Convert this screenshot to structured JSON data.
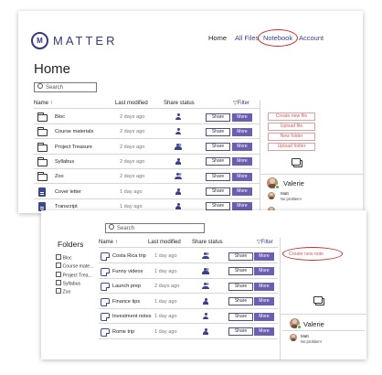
{
  "app": {
    "name": "MATTER",
    "logo_mark": "M"
  },
  "nav": {
    "items": [
      "Home",
      "All Files",
      "Notebook",
      "Account"
    ],
    "highlighted": "Notebook"
  },
  "top_panel": {
    "title": "Home",
    "search_placeholder": "Search",
    "columns": {
      "name": "Name",
      "sort_indicator": "↑",
      "modified": "Last modified",
      "share": "Share status"
    },
    "filter": "Filter",
    "rows": [
      {
        "name": "Bloc",
        "modified": "2 days ago",
        "type": "folder",
        "share": "person"
      },
      {
        "name": "Course materials",
        "modified": "2 days ago",
        "type": "folder",
        "share": "person"
      },
      {
        "name": "Project Treasure",
        "modified": "2 days ago",
        "type": "folder",
        "share": "group"
      },
      {
        "name": "Syllabus",
        "modified": "2 days ago",
        "type": "folder",
        "share": "person"
      },
      {
        "name": "Zoo",
        "modified": "2 days ago",
        "type": "folder",
        "share": "group"
      },
      {
        "name": "Cover letter",
        "modified": "1 day ago",
        "type": "doc",
        "share": "person"
      },
      {
        "name": "Transcript",
        "modified": "1 day ago",
        "type": "doc",
        "share": "person"
      }
    ],
    "share_label": "Share",
    "more_label": "More",
    "actions": [
      "Create new file",
      "Upload file",
      "New folder",
      "Upload folder"
    ],
    "user": "Valerie",
    "message": {
      "from": "Matt",
      "text": "No problem!"
    }
  },
  "bottom_panel": {
    "folders_title": "Folders",
    "folders": [
      "Bloc",
      "Course mate...",
      "Project Trea...",
      "Syllabus",
      "Zoo"
    ],
    "search_placeholder": "Search",
    "columns": {
      "name": "Name",
      "sort_indicator": "↑",
      "modified": "Last modified",
      "share": "Share status"
    },
    "filter": "Filter",
    "rows": [
      {
        "name": "Costa Rica trip",
        "modified": "1 day ago",
        "share": "group"
      },
      {
        "name": "Funny videos",
        "modified": "1 day ago",
        "share": "group"
      },
      {
        "name": "Launch prep",
        "modified": "2 days ago",
        "share": "group"
      },
      {
        "name": "Finance tips",
        "modified": "1 day ago",
        "share": "person"
      },
      {
        "name": "Investment notes",
        "modified": "1 day ago",
        "share": "person"
      },
      {
        "name": "Rome trip",
        "modified": "1 day ago",
        "share": "person"
      }
    ],
    "share_label": "Share",
    "more_label": "More",
    "action": "Create new note",
    "user": "Valerie",
    "message": {
      "from": "Matt",
      "text": "No problem!"
    }
  },
  "colors": {
    "brand": "#343a7a",
    "more_button": "#6c5fb0",
    "annotation": "#d02a2a",
    "action_text": "#d06060",
    "online": "#3cb44b"
  }
}
